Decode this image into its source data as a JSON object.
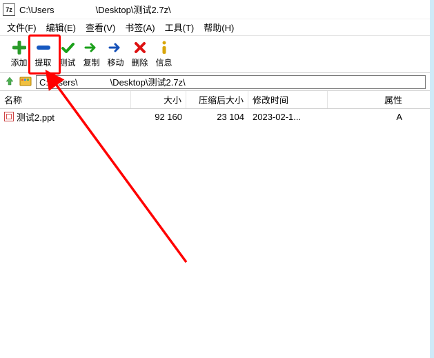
{
  "titlebar": {
    "path_prefix": "C:\\Users",
    "path_suffix": "\\Desktop\\测试2.7z\\"
  },
  "menu": {
    "file": "文件(F)",
    "edit": "编辑(E)",
    "view": "查看(V)",
    "bookmarks": "书签(A)",
    "tools": "工具(T)",
    "help": "帮助(H)"
  },
  "toolbar": {
    "add": "添加",
    "extract": "提取",
    "test": "测试",
    "copy": "复制",
    "move": "移动",
    "delete": "删除",
    "info": "信息"
  },
  "pathbar": {
    "value": "C:\\   sers\\             \\Desktop\\测试2.7z\\"
  },
  "columns": {
    "name": "名称",
    "size": "大小",
    "packed": "压缩后大小",
    "modified": "修改时间",
    "attr": "属性"
  },
  "files": [
    {
      "name": "测试2.ppt",
      "size": "92 160",
      "packed": "23 104",
      "modified": "2023-02-1...",
      "attr": "A"
    }
  ]
}
